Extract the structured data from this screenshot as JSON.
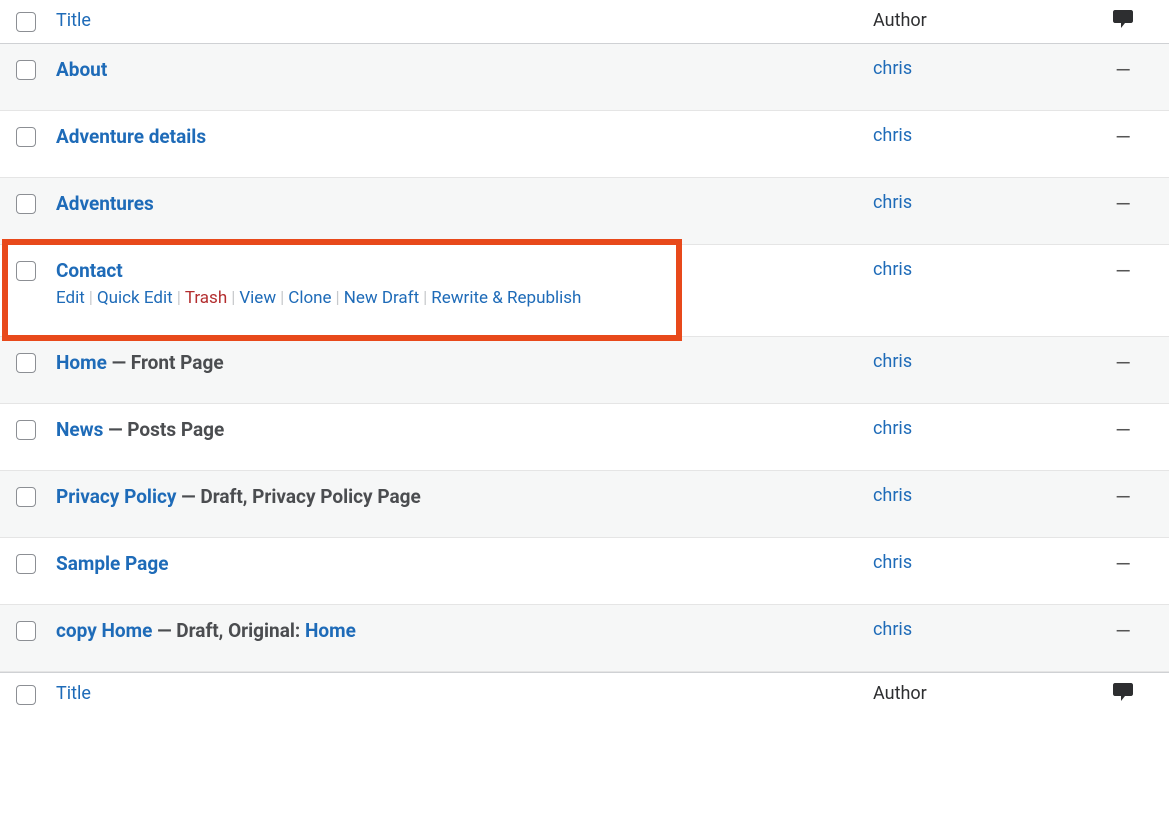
{
  "columns": {
    "title": "Title",
    "author": "Author"
  },
  "dash": "—",
  "pages": [
    {
      "title": "About",
      "suffix": "",
      "suffix_link": "",
      "author": "chris",
      "comments": "—",
      "show_actions": false
    },
    {
      "title": "Adventure details",
      "suffix": "",
      "suffix_link": "",
      "author": "chris",
      "comments": "—",
      "show_actions": false
    },
    {
      "title": "Adventures",
      "suffix": "",
      "suffix_link": "",
      "author": "chris",
      "comments": "—",
      "show_actions": false
    },
    {
      "title": "Contact",
      "suffix": "",
      "suffix_link": "",
      "author": "chris",
      "comments": "—",
      "show_actions": true,
      "highlighted": true
    },
    {
      "title": "Home",
      "suffix": " — Front Page",
      "suffix_link": "",
      "author": "chris",
      "comments": "—",
      "show_actions": false
    },
    {
      "title": "News",
      "suffix": " — Posts Page",
      "suffix_link": "",
      "author": "chris",
      "comments": "—",
      "show_actions": false
    },
    {
      "title": "Privacy Policy",
      "suffix": " — Draft, Privacy Policy Page",
      "suffix_link": "",
      "author": "chris",
      "comments": "—",
      "show_actions": false
    },
    {
      "title": "Sample Page",
      "suffix": "",
      "suffix_link": "",
      "author": "chris",
      "comments": "—",
      "show_actions": false
    },
    {
      "title": "copy Home",
      "suffix": " — Draft, Original: ",
      "suffix_link": "Home",
      "author": "chris",
      "comments": "—",
      "show_actions": false
    }
  ],
  "row_actions": {
    "edit": "Edit",
    "quick_edit": "Quick Edit",
    "trash": "Trash",
    "view": "View",
    "clone": "Clone",
    "new_draft": "New Draft",
    "rewrite_republish": "Rewrite & Republish"
  }
}
